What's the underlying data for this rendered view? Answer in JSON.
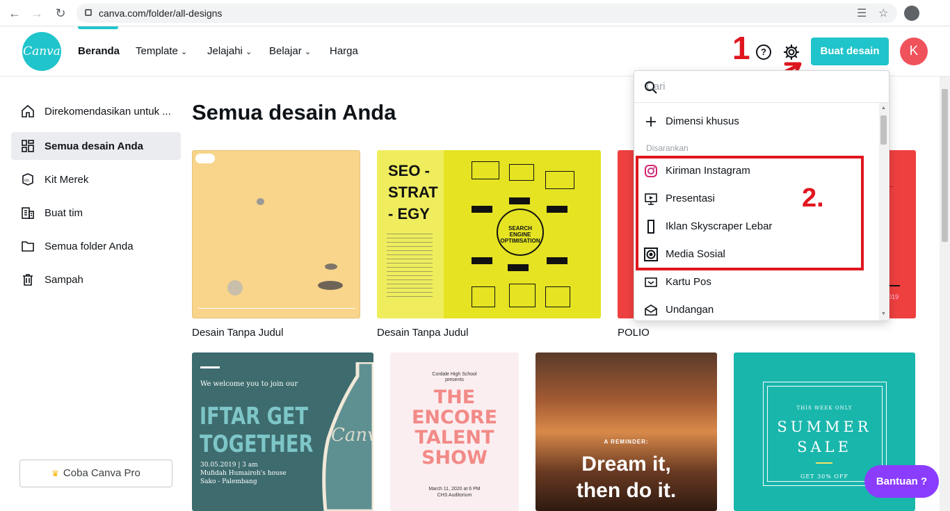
{
  "browser": {
    "url": "canva.com/folder/all-designs"
  },
  "nav": {
    "logo": "Canva",
    "items": [
      "Beranda",
      "Template",
      "Jelajahi",
      "Belajar",
      "Harga"
    ],
    "create_label": "Buat desain",
    "avatar_letter": "K",
    "help_glyph": "?",
    "annotation_1": "1"
  },
  "sidebar": {
    "items": [
      {
        "label": "Direkomendasikan untuk ...",
        "icon": "home-icon"
      },
      {
        "label": "Semua desain Anda",
        "icon": "grid-icon"
      },
      {
        "label": "Kit Merek",
        "icon": "brand-icon"
      },
      {
        "label": "Buat tim",
        "icon": "building-icon"
      },
      {
        "label": "Semua folder Anda",
        "icon": "folder-icon"
      },
      {
        "label": "Sampah",
        "icon": "trash-icon"
      }
    ],
    "pro_label": "Coba Canva Pro"
  },
  "main": {
    "title": "Semua desain Anda",
    "designs": [
      {
        "label": "Desain Tanpa Judul"
      },
      {
        "label": "Desain Tanpa Judul",
        "text_lines": [
          "SEO -",
          "STRAT",
          "- EGY"
        ],
        "badge": "SEARCH ENGINE OPTIMISATION"
      },
      {
        "label": "POLIO",
        "year": "2019"
      }
    ],
    "templates": [
      {
        "intro": "We welcome you to join our",
        "title_lines": [
          "IFTAR GET",
          "TOGETHER"
        ],
        "details": [
          "30.05.2019 | 3 am",
          "Mufidah Humairoh's house",
          "Sako - Palembang"
        ],
        "watermark": "Canva"
      },
      {
        "school": "Cordale High School",
        "presents": "presents",
        "title_lines": [
          "THE",
          "ENCORE",
          "TALENT",
          "SHOW"
        ],
        "date": "March 11, 2020 at 6 PM",
        "venue": "CHS Auditorium"
      },
      {
        "reminder": "A REMINDER:",
        "title_lines": [
          "Dream it,",
          "then do it."
        ]
      },
      {
        "top": "THIS WEEK ONLY",
        "title_lines": [
          "SUMMER",
          "SALE"
        ],
        "bottom": "GET 30% OFF"
      }
    ]
  },
  "dropdown": {
    "search_placeholder": "Cari",
    "custom": "Dimensi khusus",
    "section": "Disarankan",
    "items": [
      "Kiriman Instagram",
      "Presentasi",
      "Iklan Skyscraper Lebar",
      "Media Sosial",
      "Kartu Pos",
      "Undangan"
    ],
    "annotation_2": "2."
  },
  "help_button": "Bantuan  ?"
}
